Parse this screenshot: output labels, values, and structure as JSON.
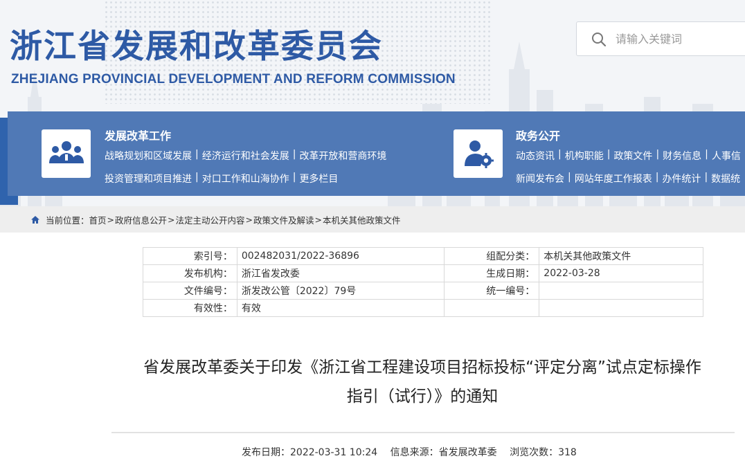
{
  "header": {
    "title": "浙江省发展和改革委员会",
    "subtitle": "ZHEJIANG PROVINCIAL DEVELOPMENT AND REFORM COMMISSION",
    "search": {
      "placeholder": "请输入关键词",
      "icon": "search-icon"
    }
  },
  "nav": {
    "colors": {
      "panel": "#5079b6",
      "strip": "#2f63ad",
      "text": "#ffffff"
    },
    "sections": [
      {
        "title": "发展改革工作",
        "icon": "people-group-icon",
        "rows": [
          [
            "战略规划和区域发展",
            "经济运行和社会发展",
            "改革开放和营商环境"
          ],
          [
            "投资管理和项目推进",
            "对口工作和山海协作",
            "更多栏目"
          ]
        ]
      },
      {
        "title": "政务公开",
        "icon": "user-gear-icon",
        "rows": [
          [
            "动态资讯",
            "机构职能",
            "政策文件",
            "财务信息",
            "人事信"
          ],
          [
            "新闻发布会",
            "网站年度工作报表",
            "办件统计",
            "数据统"
          ]
        ]
      }
    ]
  },
  "breadcrumb": {
    "prefix": "当前位置：",
    "items": [
      "首页",
      "政府信息公开",
      "法定主动公开内容",
      "政策文件及解读",
      "本机关其他政策文件"
    ],
    "icon": "home-icon"
  },
  "meta": {
    "rows": [
      {
        "label": "索引号：",
        "value": "002482031/2022-36896",
        "label2": "组配分类：",
        "value2": "本机关其他政策文件"
      },
      {
        "label": "发布机构：",
        "value": "浙江省发改委",
        "label2": "生成日期：",
        "value2": "2022-03-28"
      },
      {
        "label": "文件编号：",
        "value": "浙发改公管〔2022〕79号",
        "label2": "统一编号：",
        "value2": ""
      },
      {
        "label": "有效性：",
        "value": "有效",
        "label2": "",
        "value2": ""
      }
    ]
  },
  "article": {
    "title_line1": "省发展改革委关于印发《浙江省工程建设项目招标投标“评定分离”试点定标操作",
    "title_line2": "指引（试行）》的通知",
    "publish_date": "发布日期：2022-03-31 10:24",
    "source": "信息来源：省发展改革委",
    "views": "浏览次数：318"
  }
}
